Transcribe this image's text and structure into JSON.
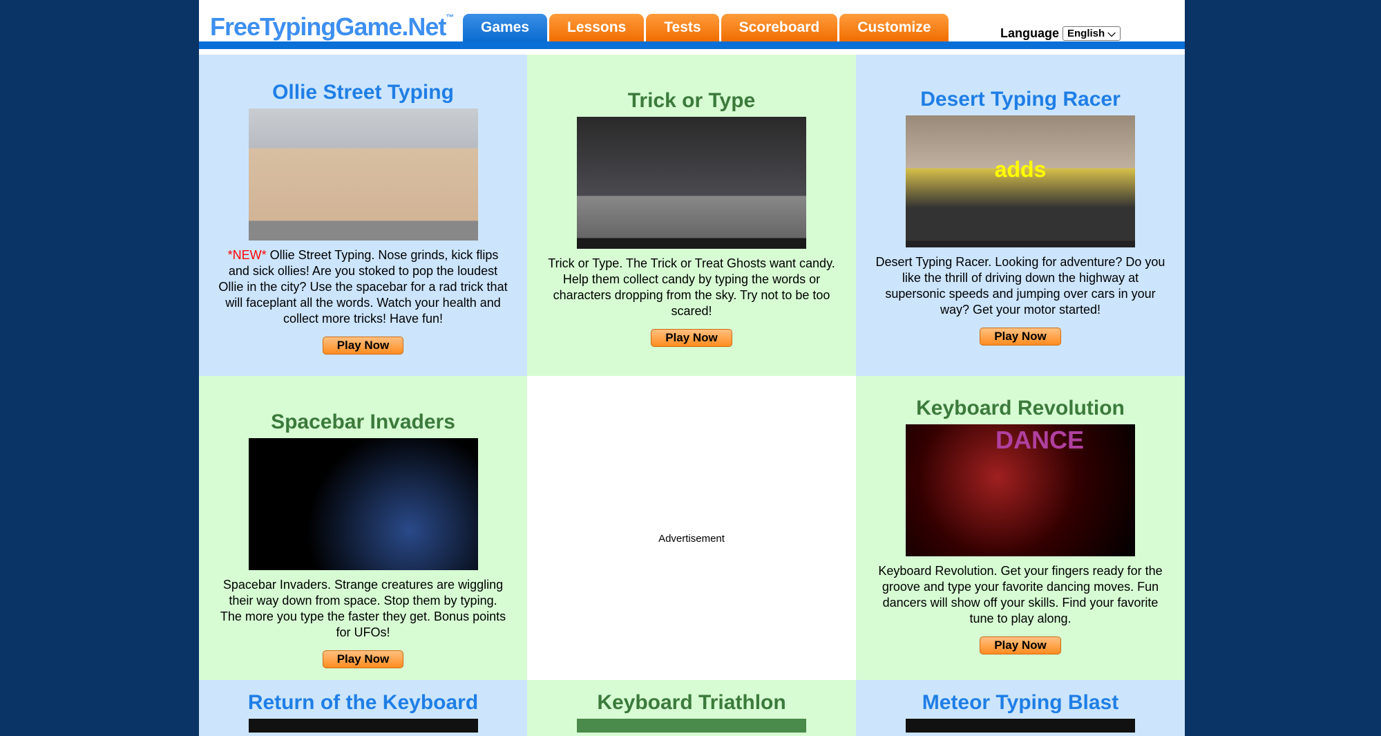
{
  "header": {
    "logo": "FreeTypingGame.Net",
    "tm": "™",
    "tabs": [
      "Games",
      "Lessons",
      "Tests",
      "Scoreboard",
      "Customize"
    ],
    "language_label": "Language",
    "language_value": "English"
  },
  "games": [
    {
      "title": "Ollie Street Typing",
      "new": "*NEW*",
      "desc": " Ollie Street Typing. Nose grinds, kick flips and sick ollies! Are you stoked to pop the loudest Ollie in the city? Use the spacebar for a rad trick that will faceplant all the words. Watch your health and collect more tricks! Have fun!",
      "button": "Play Now"
    },
    {
      "title": "Trick or Type",
      "desc": "Trick or Type. The Trick or Treat Ghosts want candy. Help them collect candy by typing the words or characters dropping from the sky. Try not to be too scared!",
      "button": "Play Now"
    },
    {
      "title": "Desert Typing Racer",
      "desc": "Desert Typing Racer. Looking for adventure? Do you like the thrill of driving down the highway at supersonic speeds and jumping over cars in your way? Get your motor started!",
      "button": "Play Now",
      "shot_word": "adds"
    },
    {
      "title": "Spacebar Invaders",
      "desc": "Spacebar Invaders. Strange creatures are wiggling their way down from space. Stop them by typing. The more you type the faster they get. Bonus points for UFOs!",
      "button": "Play Now"
    },
    {
      "title": "Keyboard Revolution",
      "desc": "Keyboard Revolution. Get your fingers ready for the groove and type your favorite dancing moves. Fun dancers will show off your skills. Find your favorite tune to play along.",
      "button": "Play Now",
      "shot_word": "DANCE"
    },
    {
      "title": "Return of the Keyboard"
    },
    {
      "title": "Keyboard Triathlon"
    },
    {
      "title": "Meteor Typing Blast"
    }
  ],
  "advertisement": "Advertisement"
}
